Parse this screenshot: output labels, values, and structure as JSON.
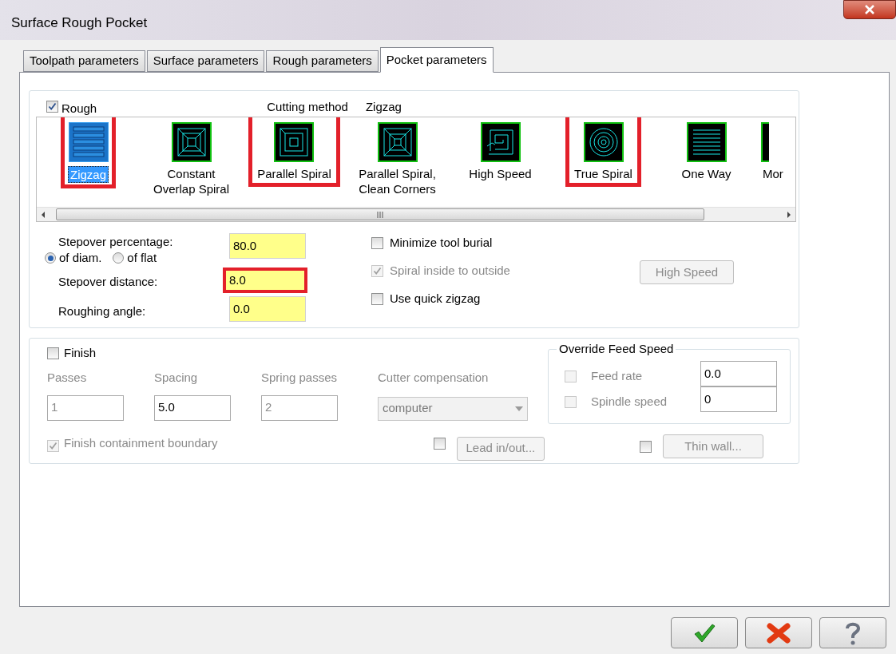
{
  "window": {
    "title": "Surface Rough Pocket"
  },
  "tabs": [
    {
      "label": "Toolpath parameters",
      "selected": false
    },
    {
      "label": "Surface parameters",
      "selected": false
    },
    {
      "label": "Rough parameters",
      "selected": false
    },
    {
      "label": "Pocket parameters",
      "selected": true
    }
  ],
  "rough": {
    "label": "Rough",
    "checked": true,
    "cutting_method_label": "Cutting method",
    "cutting_method_value": "Zigzag",
    "methods": [
      {
        "label": "Zigzag",
        "kind": "zigzag",
        "selected": true,
        "highlighted": true
      },
      {
        "label": "Constant Overlap Spiral",
        "kind": "overlap",
        "selected": false,
        "highlighted": false
      },
      {
        "label": "Parallel Spiral",
        "kind": "parallel",
        "selected": false,
        "highlighted": true
      },
      {
        "label": "Parallel Spiral, Clean Corners",
        "kind": "corners",
        "selected": false,
        "highlighted": false
      },
      {
        "label": "High Speed",
        "kind": "highspeed",
        "selected": false,
        "highlighted": false
      },
      {
        "label": "True Spiral",
        "kind": "spiral",
        "selected": false,
        "highlighted": true
      },
      {
        "label": "One Way",
        "kind": "oneway",
        "selected": false,
        "highlighted": false
      },
      {
        "label": "Mor",
        "kind": "partial",
        "selected": false,
        "highlighted": false
      }
    ],
    "stepover_percentage": {
      "label": "Stepover percentage:",
      "value": "80.0",
      "highlighted": false
    },
    "stepover_basis": [
      {
        "label": "of diam.",
        "selected": true
      },
      {
        "label": "of flat",
        "selected": false
      }
    ],
    "stepover_distance": {
      "label": "Stepover distance:",
      "value": "8.0",
      "highlighted": true
    },
    "roughing_angle": {
      "label": "Roughing angle:",
      "value": "0.0",
      "highlighted": false
    },
    "options": [
      {
        "label": "Minimize tool burial",
        "checked": false,
        "disabled": false
      },
      {
        "label": "Spiral inside to outside",
        "checked": true,
        "disabled": true
      },
      {
        "label": "Use quick zigzag",
        "checked": false,
        "disabled": false
      }
    ],
    "high_speed_button": {
      "label": "High Speed",
      "disabled": true
    }
  },
  "finish": {
    "label": "Finish",
    "checked": false,
    "fields": [
      {
        "label": "Passes",
        "value": "1",
        "disabled": true
      },
      {
        "label": "Spacing",
        "value": "5.0",
        "disabled": false
      },
      {
        "label": "Spring passes",
        "value": "2",
        "disabled": true
      }
    ],
    "cutter_compensation": {
      "label": "Cutter compensation",
      "value": "computer"
    },
    "containment": {
      "label": "Finish containment boundary",
      "checked": true
    },
    "lead_in_out": {
      "label": "Lead in/out...",
      "checked": false
    },
    "thin_wall": {
      "label": "Thin wall...",
      "checked": false
    }
  },
  "override": {
    "title": "Override Feed Speed",
    "rows": [
      {
        "label": "Feed rate",
        "checked": false,
        "value": "0.0"
      },
      {
        "label": "Spindle speed",
        "checked": false,
        "value": "0"
      }
    ]
  },
  "buttons": [
    {
      "kind": "ok"
    },
    {
      "kind": "cancel"
    },
    {
      "kind": "help"
    }
  ]
}
